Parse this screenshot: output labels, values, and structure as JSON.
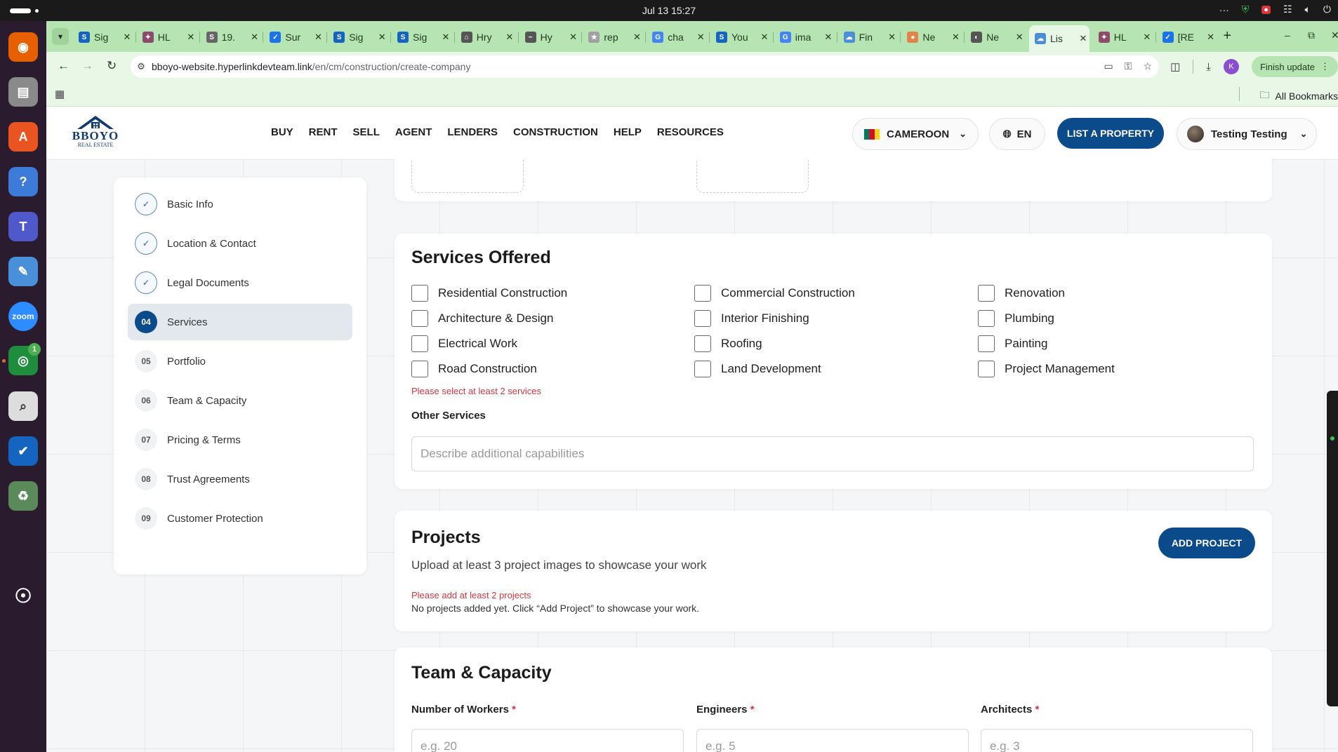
{
  "os": {
    "clock": "Jul 13  15:27",
    "menu_dots": "···"
  },
  "dock": {
    "items": [
      {
        "name": "firefox",
        "glyph": "◉",
        "color": "#e66000"
      },
      {
        "name": "files",
        "glyph": "▤",
        "color": "#8a8a8a"
      },
      {
        "name": "app-center",
        "glyph": "A",
        "color": "#e95420"
      },
      {
        "name": "help",
        "glyph": "?",
        "color": "#3d7bd9"
      },
      {
        "name": "teams",
        "glyph": "T",
        "color": "#5059c9"
      },
      {
        "name": "text-editor",
        "glyph": "✎",
        "color": "#4a8fd9"
      },
      {
        "name": "zoom",
        "glyph": "zoom",
        "color": "#2d8cff"
      },
      {
        "name": "chrome",
        "glyph": "◎",
        "color": "#1e8e3e",
        "badge": "1"
      },
      {
        "name": "search",
        "glyph": "⌕",
        "color": "#dddddd"
      },
      {
        "name": "checkmark-app",
        "glyph": "✔",
        "color": "#1565c0"
      },
      {
        "name": "trash",
        "glyph": "♻",
        "color": "#5a8a5a"
      },
      {
        "name": "ubuntu",
        "glyph": "☉",
        "color": "#2b1b2e"
      }
    ]
  },
  "browser": {
    "tabs": [
      {
        "title": "Sig",
        "fav": "S",
        "fav_color": "#1565c0"
      },
      {
        "title": "HL",
        "fav": "✦",
        "fav_color": "#8e4a6a"
      },
      {
        "title": "19.",
        "fav": "S",
        "fav_color": "#666666"
      },
      {
        "title": "Sur",
        "fav": "✓",
        "fav_color": "#1a73e8"
      },
      {
        "title": "Sig",
        "fav": "S",
        "fav_color": "#1565c0"
      },
      {
        "title": "Sig",
        "fav": "S",
        "fav_color": "#1565c0"
      },
      {
        "title": "Hry",
        "fav": "⌂",
        "fav_color": "#555555"
      },
      {
        "title": "Hy",
        "fav": "~",
        "fav_color": "#555555"
      },
      {
        "title": "rep",
        "fav": "★",
        "fav_color": "#a0a0a0"
      },
      {
        "title": "cha",
        "fav": "G",
        "fav_color": "#4285f4"
      },
      {
        "title": "You",
        "fav": "S",
        "fav_color": "#1565c0"
      },
      {
        "title": "ima",
        "fav": "G",
        "fav_color": "#4285f4"
      },
      {
        "title": "Fin",
        "fav": "☁",
        "fav_color": "#4a8fd9"
      },
      {
        "title": "Ne",
        "fav": "●",
        "fav_color": "#e0844a"
      },
      {
        "title": "Ne",
        "fav": "◐",
        "fav_color": "#555555"
      },
      {
        "title": "Lis",
        "fav": "☁",
        "fav_color": "#4a8fd9",
        "active": true
      },
      {
        "title": "HL",
        "fav": "✦",
        "fav_color": "#8e4a6a"
      },
      {
        "title": "[RE",
        "fav": "✓",
        "fav_color": "#1a73e8"
      }
    ],
    "url_host": "bboyo-website.hyperlinkdevteam.link",
    "url_path": "/en/cm/construction/create-company",
    "profile_initial": "K",
    "finish_update": "Finish update",
    "all_bookmarks": "All Bookmarks"
  },
  "site": {
    "logo_text": "BBOYO",
    "logo_sub": "REAL ESTATE",
    "nav": [
      "BUY",
      "RENT",
      "SELL",
      "AGENT",
      "LENDERS",
      "CONSTRUCTION",
      "HELP",
      "RESOURCES"
    ],
    "country": "CAMEROON",
    "language": "EN",
    "list_property": "LIST A PROPERTY",
    "user_name": "Testing Testing",
    "flag_colors": [
      "#007a5e",
      "#ce1126",
      "#fcd116"
    ]
  },
  "steps": [
    {
      "num": "✓",
      "label": "Basic Info",
      "state": "done"
    },
    {
      "num": "✓",
      "label": "Location & Contact",
      "state": "done"
    },
    {
      "num": "✓",
      "label": "Legal Documents",
      "state": "done"
    },
    {
      "num": "04",
      "label": "Services",
      "state": "current"
    },
    {
      "num": "05",
      "label": "Portfolio",
      "state": "todo"
    },
    {
      "num": "06",
      "label": "Team & Capacity",
      "state": "todo"
    },
    {
      "num": "07",
      "label": "Pricing & Terms",
      "state": "todo"
    },
    {
      "num": "08",
      "label": "Trust Agreements",
      "state": "todo"
    },
    {
      "num": "09",
      "label": "Customer Protection",
      "state": "todo"
    }
  ],
  "services": {
    "title": "Services Offered",
    "options": [
      [
        "Residential Construction",
        "Commercial Construction",
        "Renovation"
      ],
      [
        "Architecture & Design",
        "Interior Finishing",
        "Plumbing"
      ],
      [
        "Electrical Work",
        "Roofing",
        "Painting"
      ],
      [
        "Road Construction",
        "Land Development",
        "Project Management"
      ]
    ],
    "error": "Please select at least 2 services",
    "other_label": "Other Services",
    "other_placeholder": "Describe additional capabilities"
  },
  "projects": {
    "title": "Projects",
    "subtitle": "Upload at least 3 project images to showcase your work",
    "add_button": "ADD PROJECT",
    "error": "Please add at least 2 projects",
    "empty": "No projects added yet. Click “Add Project” to showcase your work."
  },
  "team": {
    "title": "Team & Capacity",
    "fields": [
      {
        "label": "Number of Workers",
        "placeholder": "e.g. 20"
      },
      {
        "label": "Engineers",
        "placeholder": "e.g. 5"
      },
      {
        "label": "Architects",
        "placeholder": "e.g. 3"
      }
    ]
  }
}
